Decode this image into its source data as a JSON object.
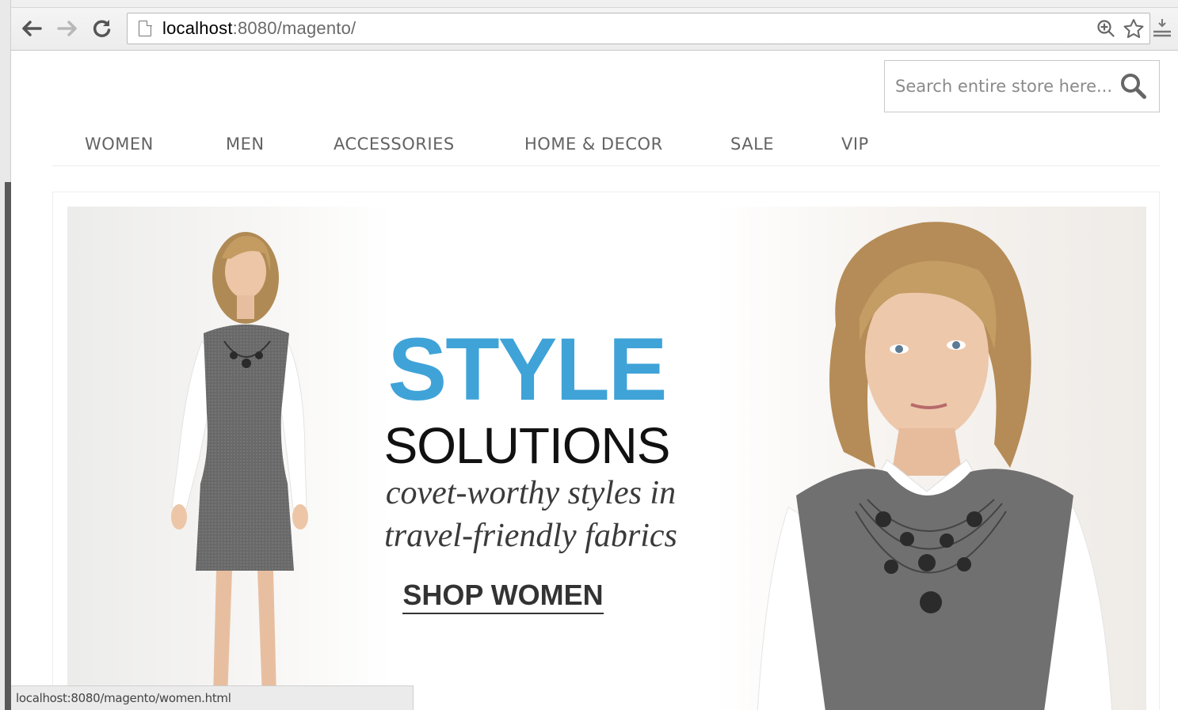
{
  "browser": {
    "url_host": "localhost",
    "url_rest": ":8080/magento/",
    "status_url": "localhost:8080/magento/women.html"
  },
  "header": {
    "search_placeholder": "Search entire store here..."
  },
  "nav": {
    "items": [
      {
        "label": "WOMEN"
      },
      {
        "label": "MEN"
      },
      {
        "label": "ACCESSORIES"
      },
      {
        "label": "HOME & DECOR"
      },
      {
        "label": "SALE"
      },
      {
        "label": "VIP"
      }
    ]
  },
  "hero": {
    "title": "STYLE",
    "subtitle": "SOLUTIONS",
    "tagline_line1": "covet-worthy styles in",
    "tagline_line2": "travel-friendly fabrics",
    "cta": "SHOP WOMEN"
  },
  "colors": {
    "accent": "#3fa3d8",
    "nav_text": "#636363"
  },
  "icons": [
    "back-arrow-icon",
    "forward-arrow-icon",
    "reload-icon",
    "page-icon",
    "zoom-icon",
    "star-icon",
    "menu-icon",
    "search-icon"
  ]
}
